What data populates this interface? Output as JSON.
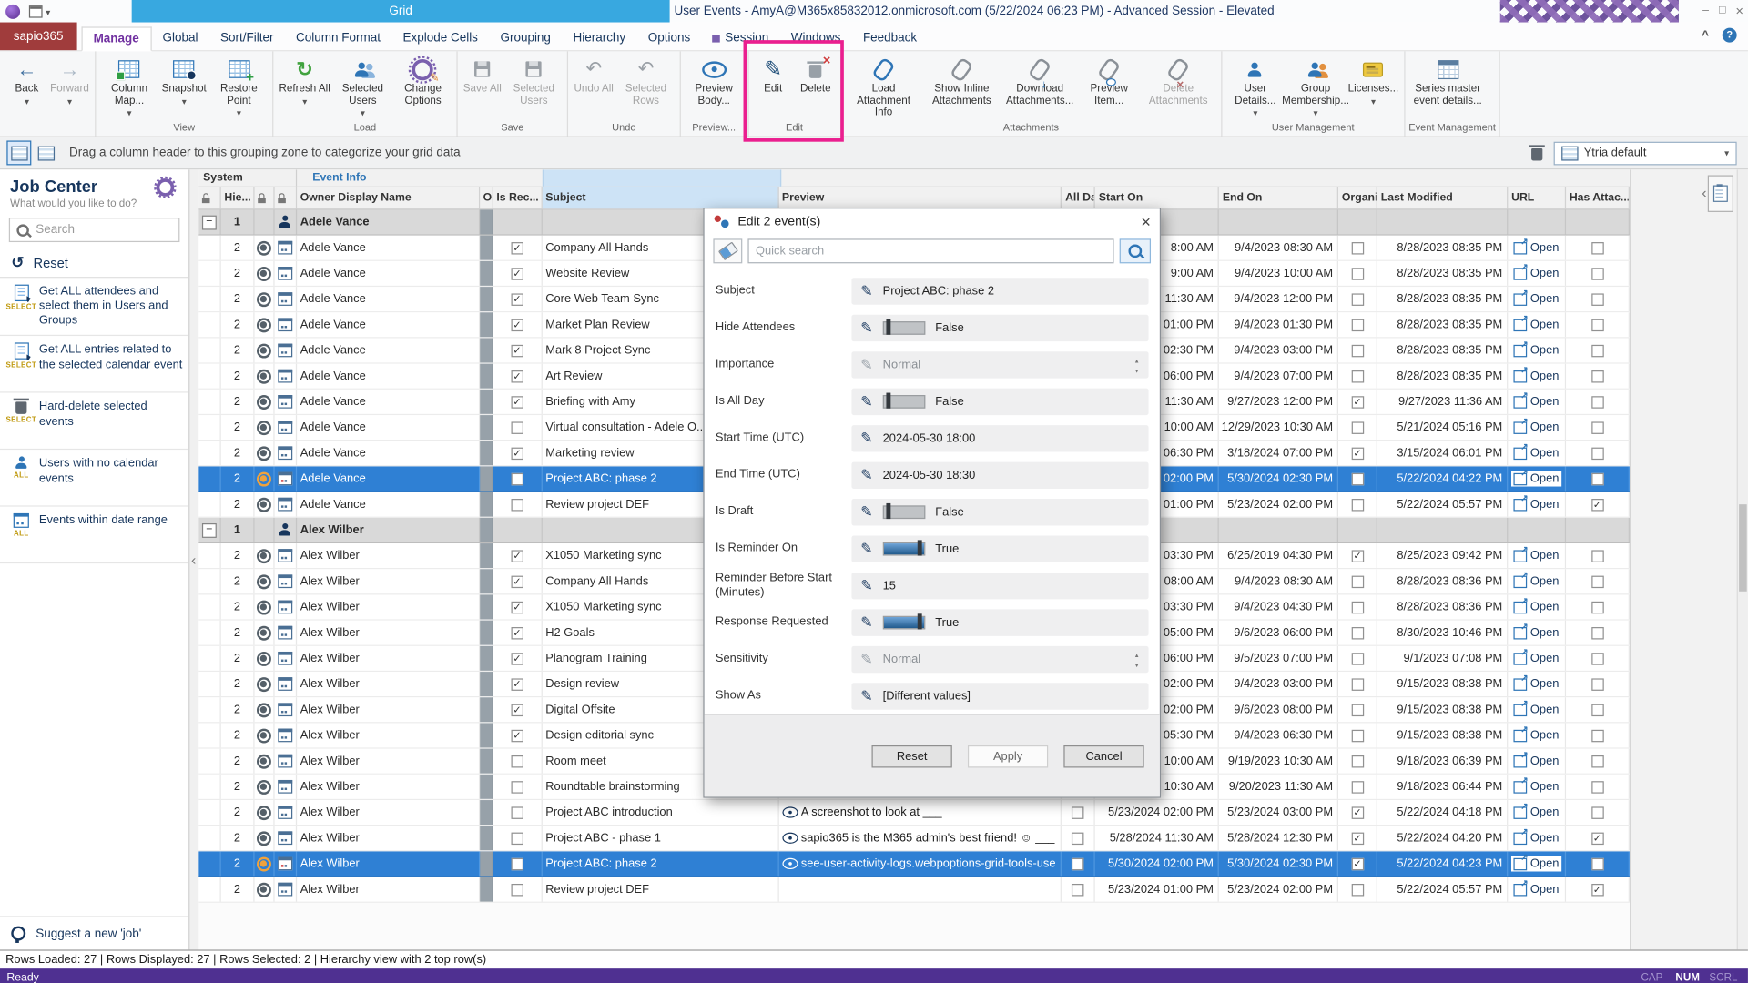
{
  "titlebar": {
    "app_tab": "Grid",
    "window_title": "User Events - AmyA@M365x85832012.onmicrosoft.com (5/22/2024 06:23 PM) - Advanced Session - Elevated"
  },
  "tabs": [
    {
      "label": "sapio365",
      "style": "brand"
    },
    {
      "label": "Manage",
      "style": "active"
    },
    {
      "label": "Global"
    },
    {
      "label": "Sort/Filter"
    },
    {
      "label": "Column Format"
    },
    {
      "label": "Explode Cells"
    },
    {
      "label": "Grouping"
    },
    {
      "label": "Hierarchy"
    },
    {
      "label": "Options"
    },
    {
      "label": "Session",
      "icon": true
    },
    {
      "label": "Windows"
    },
    {
      "label": "Feedback"
    }
  ],
  "ribbon": {
    "groups": [
      {
        "label": "",
        "buttons": [
          {
            "label": "Back",
            "icon": "back-icon",
            "caret": true
          },
          {
            "label": "Forward",
            "icon": "forward-icon",
            "caret": true,
            "disabled": true
          }
        ]
      },
      {
        "label": "View",
        "buttons": [
          {
            "label": "Column Map...",
            "icon": "column-map-icon",
            "caret": true
          },
          {
            "label": "Snapshot",
            "icon": "snapshot-icon",
            "caret": true
          },
          {
            "label": "Restore Point",
            "icon": "restore-point-icon",
            "caret": true
          }
        ]
      },
      {
        "label": "Load",
        "buttons": [
          {
            "label": "Refresh All",
            "icon": "refresh-icon",
            "caret": true
          },
          {
            "label": "Selected Users",
            "icon": "users-refresh-icon",
            "caret": true
          },
          {
            "label": "Change Options",
            "icon": "change-options-icon"
          }
        ]
      },
      {
        "label": "Save",
        "buttons": [
          {
            "label": "Save All",
            "icon": "save-all-icon",
            "disabled": true
          },
          {
            "label": "Selected Users",
            "icon": "save-users-icon",
            "disabled": true
          }
        ]
      },
      {
        "label": "Undo",
        "buttons": [
          {
            "label": "Undo All",
            "icon": "undo-all-icon",
            "disabled": true
          },
          {
            "label": "Selected Rows",
            "icon": "undo-rows-icon",
            "disabled": true
          }
        ]
      },
      {
        "label": "Preview...",
        "buttons": [
          {
            "label": "Preview Body...",
            "icon": "preview-body-icon"
          }
        ]
      },
      {
        "label": "Edit",
        "buttons": [
          {
            "label": "Edit",
            "icon": "edit-pencil-icon"
          },
          {
            "label": "Delete",
            "icon": "delete-icon"
          }
        ]
      },
      {
        "label": "Attachments",
        "buttons": [
          {
            "label": "Load Attachment Info",
            "icon": "load-attachment-icon",
            "wide": true
          },
          {
            "label": "Show Inline Attachments",
            "icon": "inline-attachments-icon",
            "wide": true
          },
          {
            "label": "Download Attachments...",
            "icon": "download-attachments-icon",
            "wide": true
          },
          {
            "label": "Preview Item...",
            "icon": "preview-item-icon"
          },
          {
            "label": "Delete Attachments",
            "icon": "delete-attachments-icon",
            "wide": true,
            "disabled": true
          }
        ]
      },
      {
        "label": "User Management",
        "buttons": [
          {
            "label": "User Details...",
            "icon": "user-details-icon",
            "caret": true
          },
          {
            "label": "Group Membership...",
            "icon": "group-membership-icon",
            "caret": true
          },
          {
            "label": "Licenses...",
            "icon": "licenses-icon",
            "caret": true
          }
        ]
      },
      {
        "label": "Event Management",
        "buttons": [
          {
            "label": "Series master event details...",
            "icon": "series-master-icon",
            "wide": true
          }
        ]
      }
    ]
  },
  "grouping_bar": {
    "hint": "Drag a column header to this grouping zone to categorize your grid data",
    "preset": "Ytria default"
  },
  "sidebar": {
    "title": "Job Center",
    "subtitle": "What would you like to do?",
    "search_placeholder": "Search",
    "reset_label": "Reset",
    "jobs": [
      {
        "badge": "SELECT",
        "icon": "list-select-icon",
        "text": "Get ALL attendees and select them in Users and Groups"
      },
      {
        "badge": "SELECT",
        "icon": "list-select-icon",
        "text": "Get ALL entries related to the selected calendar event"
      },
      {
        "badge": "SELECT",
        "icon": "trash-icon",
        "text": "Hard-delete selected events"
      },
      {
        "badge": "ALL",
        "icon": "user-doc-icon",
        "text": "Users with no calendar events"
      },
      {
        "badge": "ALL",
        "icon": "calendar-range-icon",
        "text": "Events within date range"
      }
    ],
    "footer_label": "Suggest a new 'job'"
  },
  "grid": {
    "band_system": "System",
    "band_event_info": "Event Info",
    "url_label": "Open",
    "columns": [
      {
        "label": "",
        "lock": true
      },
      {
        "label": "Hie..."
      },
      {
        "label": "",
        "lock": true
      },
      {
        "label": "",
        "lock": true
      },
      {
        "label": "Owner Display Name"
      },
      {
        "label": "O..."
      },
      {
        "label": "Is Rec..."
      },
      {
        "label": "Subject",
        "highlight": true
      },
      {
        "label": "Preview"
      },
      {
        "label": "All Day"
      },
      {
        "label": "Start On"
      },
      {
        "label": "End On"
      },
      {
        "label": "Organi..."
      },
      {
        "label": "Last Modified"
      },
      {
        "label": "URL"
      },
      {
        "label": "Has Attac..."
      }
    ],
    "groups": [
      {
        "name": "Adele Vance",
        "level": "1",
        "child_level": "2",
        "rows": [
          {
            "subject": "Company All Hands",
            "is_recurring": true,
            "preview": "",
            "all_day": false,
            "start_on": "8:00 AM",
            "end_on": "9/4/2023 08:30 AM",
            "is_organizer": false,
            "last_modified": "8/28/2023 08:35 PM",
            "has_attachments": false,
            "selected": false
          },
          {
            "subject": "Website Review",
            "is_recurring": true,
            "preview": "",
            "all_day": false,
            "start_on": "9:00 AM",
            "end_on": "9/4/2023 10:00 AM",
            "is_organizer": false,
            "last_modified": "8/28/2023 08:35 PM",
            "has_attachments": false,
            "selected": false
          },
          {
            "subject": "Core Web Team Sync",
            "is_recurring": true,
            "preview": "",
            "all_day": false,
            "start_on": "11:30 AM",
            "end_on": "9/4/2023 12:00 PM",
            "is_organizer": false,
            "last_modified": "8/28/2023 08:35 PM",
            "has_attachments": false,
            "selected": false
          },
          {
            "subject": "Market Plan Review",
            "is_recurring": true,
            "preview": "",
            "all_day": false,
            "start_on": "01:00 PM",
            "end_on": "9/4/2023 01:30 PM",
            "is_organizer": false,
            "last_modified": "8/28/2023 08:35 PM",
            "has_attachments": false,
            "selected": false
          },
          {
            "subject": "Mark 8 Project Sync",
            "is_recurring": true,
            "preview": "",
            "all_day": false,
            "start_on": "02:30 PM",
            "end_on": "9/4/2023 03:00 PM",
            "is_organizer": false,
            "last_modified": "8/28/2023 08:35 PM",
            "has_attachments": false,
            "selected": false
          },
          {
            "subject": "Art Review",
            "is_recurring": true,
            "preview": "",
            "all_day": false,
            "start_on": "06:00 PM",
            "end_on": "9/4/2023 07:00 PM",
            "is_organizer": false,
            "last_modified": "8/28/2023 08:35 PM",
            "has_attachments": false,
            "selected": false
          },
          {
            "subject": "Briefing with Amy",
            "is_recurring": true,
            "preview": "",
            "all_day": false,
            "start_on": "11:30 AM",
            "end_on": "9/27/2023 12:00 PM",
            "is_organizer": true,
            "last_modified": "9/27/2023 11:36 AM",
            "has_attachments": false,
            "selected": false
          },
          {
            "subject": "Virtual consultation - Adele O...",
            "is_recurring": false,
            "preview": "",
            "all_day": false,
            "start_on": "10:00 AM",
            "end_on": "12/29/2023 10:30 AM",
            "is_organizer": false,
            "last_modified": "5/21/2024 05:16 PM",
            "has_attachments": false,
            "selected": false
          },
          {
            "subject": "Marketing review",
            "is_recurring": true,
            "preview": "",
            "all_day": false,
            "start_on": "06:30 PM",
            "end_on": "3/18/2024 07:00 PM",
            "is_organizer": true,
            "last_modified": "3/15/2024 06:01 PM",
            "has_attachments": false,
            "selected": false
          },
          {
            "subject": "Project ABC: phase 2",
            "is_recurring": false,
            "preview": "",
            "all_day": false,
            "start_on": "02:00 PM",
            "end_on": "5/30/2024 02:30 PM",
            "is_organizer": false,
            "last_modified": "5/22/2024 04:22 PM",
            "has_attachments": false,
            "selected": true
          },
          {
            "subject": "Review project DEF",
            "is_recurring": false,
            "preview": "",
            "all_day": false,
            "start_on": "01:00 PM",
            "end_on": "5/23/2024 02:00 PM",
            "is_organizer": false,
            "last_modified": "5/22/2024 05:57 PM",
            "has_attachments": true,
            "selected": false
          }
        ]
      },
      {
        "name": "Alex Wilber",
        "level": "1",
        "child_level": "2",
        "rows": [
          {
            "subject": "X1050 Marketing sync",
            "is_recurring": true,
            "preview": "",
            "all_day": false,
            "start_on": "03:30 PM",
            "end_on": "6/25/2019 04:30 PM",
            "is_organizer": true,
            "last_modified": "8/25/2023 09:42 PM",
            "has_attachments": false,
            "selected": false
          },
          {
            "subject": "Company All Hands",
            "is_recurring": true,
            "preview": "",
            "all_day": false,
            "start_on": "08:00 AM",
            "end_on": "9/4/2023 08:30 AM",
            "is_organizer": false,
            "last_modified": "8/28/2023 08:36 PM",
            "has_attachments": false,
            "selected": false
          },
          {
            "subject": "X1050 Marketing sync",
            "is_recurring": true,
            "preview": "",
            "all_day": false,
            "start_on": "03:30 PM",
            "end_on": "9/4/2023 04:30 PM",
            "is_organizer": false,
            "last_modified": "8/28/2023 08:36 PM",
            "has_attachments": false,
            "selected": false
          },
          {
            "subject": "H2 Goals",
            "is_recurring": true,
            "preview": "",
            "all_day": false,
            "start_on": "05:00 PM",
            "end_on": "9/6/2023 06:00 PM",
            "is_organizer": false,
            "last_modified": "8/30/2023 10:46 PM",
            "has_attachments": false,
            "selected": false
          },
          {
            "subject": "Planogram Training",
            "is_recurring": true,
            "preview": "",
            "all_day": false,
            "start_on": "06:00 PM",
            "end_on": "9/5/2023 07:00 PM",
            "is_organizer": false,
            "last_modified": "9/1/2023 07:08 PM",
            "has_attachments": false,
            "selected": false
          },
          {
            "subject": "Design review",
            "is_recurring": true,
            "preview": "",
            "all_day": false,
            "start_on": "02:00 PM",
            "end_on": "9/4/2023 03:00 PM",
            "is_organizer": false,
            "last_modified": "9/15/2023 08:38 PM",
            "has_attachments": false,
            "selected": false
          },
          {
            "subject": "Digital Offsite",
            "is_recurring": true,
            "preview": "",
            "all_day": false,
            "start_on": "02:00 PM",
            "end_on": "9/6/2023 08:00 PM",
            "is_organizer": false,
            "last_modified": "9/15/2023 08:38 PM",
            "has_attachments": false,
            "selected": false
          },
          {
            "subject": "Design editorial sync",
            "is_recurring": true,
            "preview": "",
            "all_day": false,
            "start_on": "05:30 PM",
            "end_on": "9/4/2023 06:30 PM",
            "is_organizer": false,
            "last_modified": "9/15/2023 08:38 PM",
            "has_attachments": false,
            "selected": false
          },
          {
            "subject": "Room meet",
            "is_recurring": false,
            "preview": "",
            "all_day": false,
            "start_on": "10:00 AM",
            "end_on": "9/19/2023 10:30 AM",
            "is_organizer": false,
            "last_modified": "9/18/2023 06:39 PM",
            "has_attachments": false,
            "selected": false
          },
          {
            "subject": "Roundtable brainstorming",
            "is_recurring": false,
            "preview": "",
            "all_day": false,
            "start_on": "10:30 AM",
            "end_on": "9/20/2023 11:30 AM",
            "is_organizer": false,
            "last_modified": "9/18/2023 06:44 PM",
            "has_attachments": false,
            "selected": false
          },
          {
            "subject": "Project ABC introduction",
            "is_recurring": false,
            "preview": "A screenshot to look at ___",
            "all_day": false,
            "start_on": "5/23/2024 02:00 PM",
            "end_on": "5/23/2024 03:00 PM",
            "is_organizer": true,
            "last_modified": "5/22/2024 04:18 PM",
            "has_attachments": false,
            "selected": false
          },
          {
            "subject": "Project ABC - phase 1",
            "is_recurring": false,
            "preview": "sapio365 is the M365 admin's best friend! ☺ ___",
            "all_day": false,
            "start_on": "5/28/2024 11:30 AM",
            "end_on": "5/28/2024 12:30 PM",
            "is_organizer": true,
            "last_modified": "5/22/2024 04:20 PM",
            "has_attachments": true,
            "selected": false
          },
          {
            "subject": "Project ABC: phase 2",
            "is_recurring": false,
            "preview": "see-user-activity-logs.webpoptions-grid-tools-use",
            "all_day": false,
            "start_on": "5/30/2024 02:00 PM",
            "end_on": "5/30/2024 02:30 PM",
            "is_organizer": true,
            "last_modified": "5/22/2024 04:23 PM",
            "has_attachments": false,
            "selected": true
          },
          {
            "subject": "Review project DEF",
            "is_recurring": false,
            "preview": "",
            "all_day": false,
            "start_on": "5/23/2024 01:00 PM",
            "end_on": "5/23/2024 02:00 PM",
            "is_organizer": false,
            "last_modified": "5/22/2024 05:57 PM",
            "has_attachments": true,
            "selected": false
          }
        ]
      }
    ]
  },
  "dialog": {
    "title": "Edit 2 event(s)",
    "search_placeholder": "Quick search",
    "fields": [
      {
        "label": "Subject",
        "type": "text",
        "value": "Project ABC: phase 2"
      },
      {
        "label": "Hide Attendees",
        "type": "toggle",
        "value": "False",
        "on": false
      },
      {
        "label": "Importance",
        "type": "select",
        "value": "Normal",
        "disabled": true
      },
      {
        "label": "Is All Day",
        "type": "toggle",
        "value": "False",
        "on": false
      },
      {
        "label": "Start Time (UTC)",
        "type": "text",
        "value": "2024-05-30 18:00"
      },
      {
        "label": "End Time (UTC)",
        "type": "text",
        "value": "2024-05-30 18:30"
      },
      {
        "label": "Is Draft",
        "type": "toggle",
        "value": "False",
        "on": false
      },
      {
        "label": "Is Reminder On",
        "type": "toggle",
        "value": "True",
        "on": true
      },
      {
        "label": "Reminder Before Start (Minutes)",
        "type": "text",
        "value": "15"
      },
      {
        "label": "Response Requested",
        "type": "toggle",
        "value": "True",
        "on": true
      },
      {
        "label": "Sensitivity",
        "type": "select",
        "value": "Normal",
        "disabled": true
      },
      {
        "label": "Show As",
        "type": "text",
        "value": "[Different values]"
      }
    ],
    "buttons": {
      "reset": "Reset",
      "apply": "Apply",
      "cancel": "Cancel"
    }
  },
  "statusbar": {
    "text": "Rows Loaded: 27 | Rows Displayed: 27 | Rows Selected: 2 | Hierarchy view with 2 top row(s)"
  },
  "bottombar": {
    "ready": "Ready",
    "cap": "CAP",
    "num": "NUM",
    "scrl": "SCRL"
  }
}
